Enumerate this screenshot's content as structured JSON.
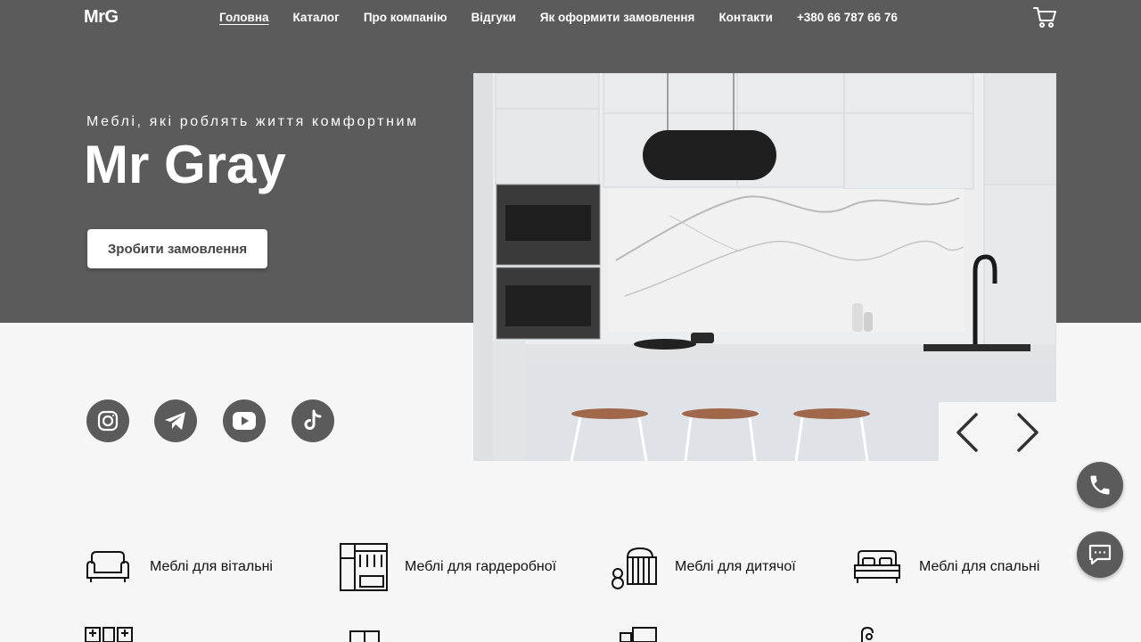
{
  "header": {
    "logo": "MrG",
    "nav": [
      {
        "label": "Головна",
        "active": true
      },
      {
        "label": "Каталог"
      },
      {
        "label": "Про компанію"
      },
      {
        "label": "Відгуки"
      },
      {
        "label": "Як оформити замовлення"
      },
      {
        "label": "Контакти"
      },
      {
        "label": "+380 66 787 66 76"
      }
    ],
    "cart_icon": "cart-icon"
  },
  "hero": {
    "tagline": "Меблі, які роблять життя комфортним",
    "brand": "Mr Gray",
    "cta_label": "Зробити замовлення"
  },
  "socials": [
    "instagram-icon",
    "telegram-icon",
    "youtube-icon",
    "tiktok-icon"
  ],
  "categories": [
    {
      "label": "Меблі для вітальні",
      "icon": "sofa-icon"
    },
    {
      "label": "Меблі для гардеробної",
      "icon": "wardrobe-icon"
    },
    {
      "label": "Меблі для дитячої",
      "icon": "crib-icon"
    },
    {
      "label": "Меблі для спальні",
      "icon": "bed-icon"
    }
  ],
  "colors": {
    "band": "#5b5b5b",
    "page": "#f6f6f6",
    "accent": "#ffffff"
  }
}
